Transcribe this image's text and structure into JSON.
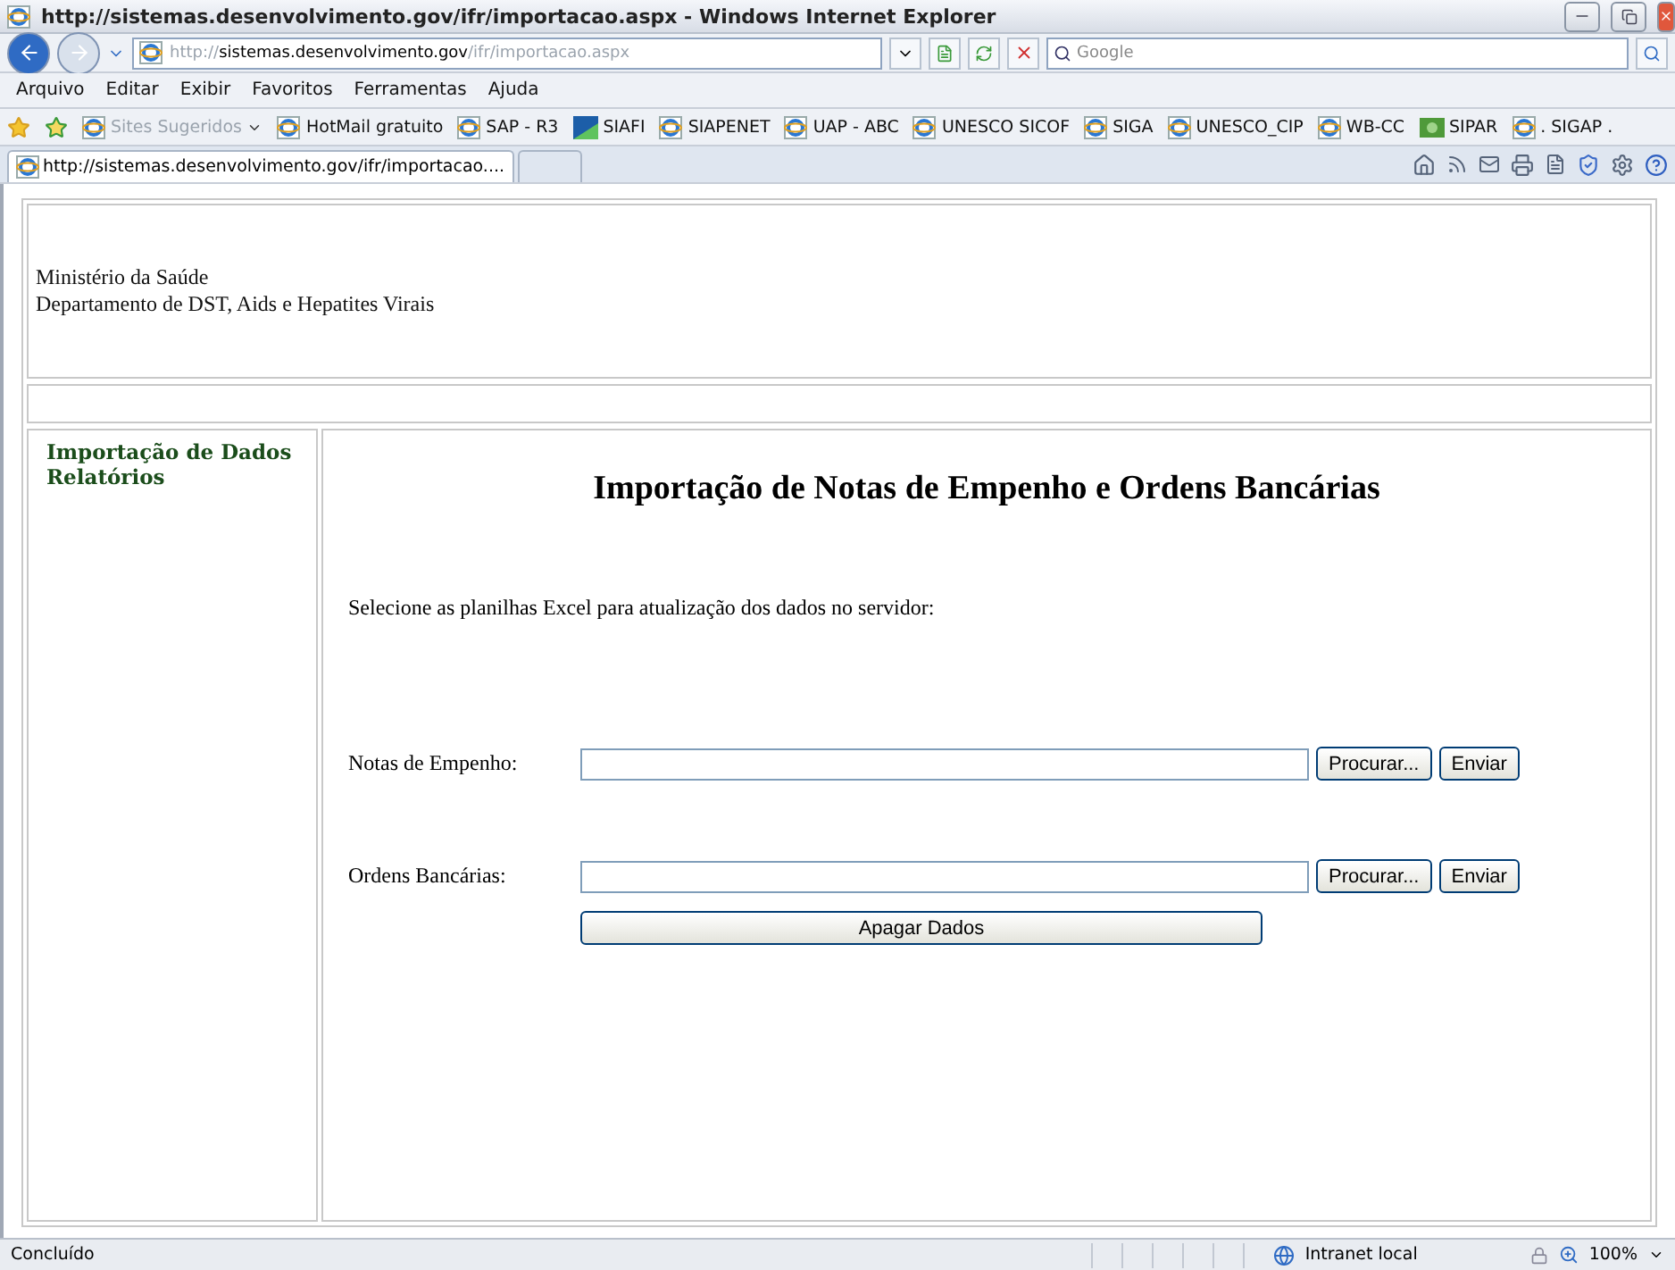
{
  "window": {
    "title": "http://sistemas.desenvolvimento.gov/ifr/importacao.aspx - Windows Internet Explorer"
  },
  "address": {
    "scheme": "http://",
    "host": "sistemas.desenvolvimento.gov",
    "path": "/ifr/importacao.aspx"
  },
  "search": {
    "placeholder": "Google"
  },
  "menu": [
    "Arquivo",
    "Editar",
    "Exibir",
    "Favoritos",
    "Ferramentas",
    "Ajuda"
  ],
  "favorites": [
    {
      "label": "Sites Sugeridos",
      "kind": "dropdown",
      "disabled": true
    },
    {
      "label": "HotMail gratuito",
      "kind": "ie",
      "disabled": false
    },
    {
      "label": "SAP - R3",
      "kind": "ie",
      "disabled": false
    },
    {
      "label": "SIAFI",
      "kind": "siafi",
      "disabled": false
    },
    {
      "label": "SIAPENET",
      "kind": "ie",
      "disabled": false
    },
    {
      "label": "UAP - ABC",
      "kind": "ie",
      "disabled": false
    },
    {
      "label": "UNESCO SICOF",
      "kind": "ie",
      "disabled": false
    },
    {
      "label": "SIGA",
      "kind": "ie",
      "disabled": false
    },
    {
      "label": "UNESCO_CIP",
      "kind": "ie",
      "disabled": false
    },
    {
      "label": "WB-CC",
      "kind": "ie",
      "disabled": false
    },
    {
      "label": "SIPAR",
      "kind": "sipar",
      "disabled": false
    },
    {
      "label": ". SIGAP .",
      "kind": "ie",
      "disabled": false
    }
  ],
  "tabs": [
    {
      "label": "http://sistemas.desenvolvimento.gov/ifr/importacao....",
      "selected": true
    }
  ],
  "page": {
    "header": [
      "Ministério da Saúde",
      "Departamento de DST, Aids e Hepatites Virais"
    ],
    "sidebar": {
      "items": [
        "Importação de Dados",
        "Relatórios"
      ]
    },
    "title": "Importação de Notas de Empenho e Ordens Bancárias",
    "instructions": "Selecione as planilhas Excel para atualização dos dados no servidor:",
    "uploads": [
      {
        "label": "Notas de Empenho:",
        "browse": "Procurar...",
        "send": "Enviar"
      },
      {
        "label": "Ordens Bancárias:",
        "browse": "Procurar...",
        "send": "Enviar"
      }
    ],
    "clear_button": "Apagar Dados"
  },
  "status_bar": {
    "text": "Concluído",
    "zone": "Intranet local",
    "zoom": "100%"
  }
}
